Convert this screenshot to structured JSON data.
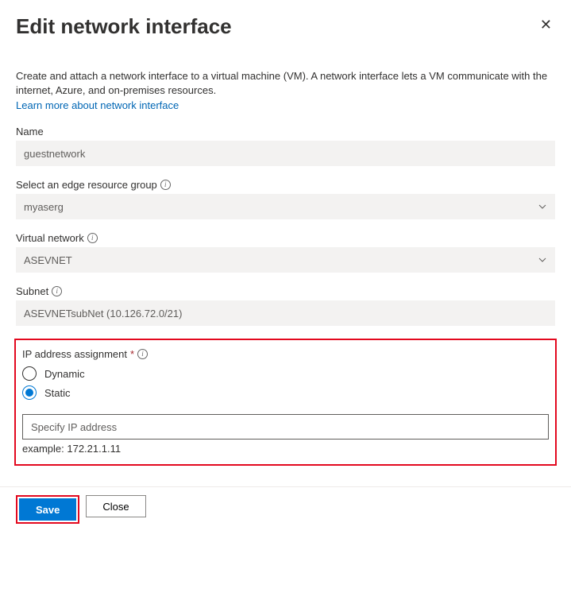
{
  "header": {
    "title": "Edit network interface"
  },
  "description": "Create and attach a network interface to a virtual machine (VM). A network interface lets a VM communicate with the internet, Azure, and on-premises resources.",
  "learnMore": "Learn more about network interface",
  "fields": {
    "name": {
      "label": "Name",
      "value": "guestnetwork"
    },
    "resourceGroup": {
      "label": "Select an edge resource group",
      "value": "myaserg"
    },
    "vnet": {
      "label": "Virtual network",
      "value": "ASEVNET"
    },
    "subnet": {
      "label": "Subnet",
      "value": "ASEVNETsubNet (10.126.72.0/21)"
    },
    "ipAssignment": {
      "label": "IP address assignment",
      "options": {
        "dynamic": "Dynamic",
        "static": "Static"
      },
      "ipPlaceholder": "Specify IP address",
      "example": "example: 172.21.1.11"
    }
  },
  "footer": {
    "save": "Save",
    "close": "Close"
  }
}
